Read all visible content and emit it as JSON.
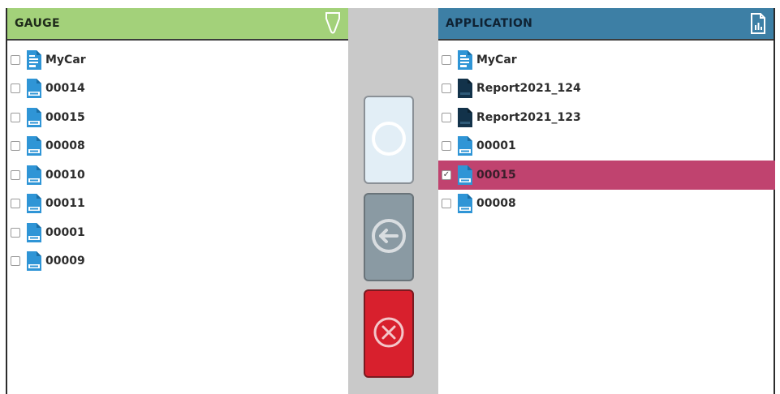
{
  "colors": {
    "gauge_header": "#a3d17a",
    "application_header": "#3d7fa5",
    "selected_row": "#c0436f",
    "add_button": "#e2eef6",
    "back_button": "#8a9aa3",
    "cancel_button": "#d8202d",
    "middle_column": "#c9c9c9"
  },
  "left_panel": {
    "title": "GAUGE",
    "header_icon": "gauge-probe-icon",
    "items": [
      {
        "label": "MyCar",
        "icon": "folder-file-icon",
        "checked": false
      },
      {
        "label": "00014",
        "icon": "job-file-icon",
        "checked": false
      },
      {
        "label": "00015",
        "icon": "job-file-icon",
        "checked": false
      },
      {
        "label": "00008",
        "icon": "job-file-icon",
        "checked": false
      },
      {
        "label": "00010",
        "icon": "job-file-icon",
        "checked": false
      },
      {
        "label": "00011",
        "icon": "job-file-icon",
        "checked": false
      },
      {
        "label": "00001",
        "icon": "job-file-icon",
        "checked": false
      },
      {
        "label": "00009",
        "icon": "job-file-icon",
        "checked": false
      }
    ]
  },
  "right_panel": {
    "title": "APPLICATION",
    "header_icon": "report-document-icon",
    "items": [
      {
        "label": "MyCar",
        "icon": "folder-file-icon",
        "checked": false
      },
      {
        "label": "Report2021_124",
        "icon": "report-file-icon",
        "checked": false
      },
      {
        "label": "Report2021_123",
        "icon": "report-file-icon",
        "checked": false
      },
      {
        "label": "00001",
        "icon": "job-file-icon",
        "checked": false
      },
      {
        "label": "00015",
        "icon": "job-file-icon",
        "checked": true,
        "selected": true
      },
      {
        "label": "00008",
        "icon": "job-file-icon",
        "checked": false
      }
    ]
  },
  "middle_buttons": {
    "add": {
      "icon": "circle-icon",
      "enabled": true
    },
    "back": {
      "icon": "arrow-left-circle-icon",
      "enabled": false
    },
    "cancel": {
      "icon": "close-circle-icon",
      "enabled": true
    }
  }
}
